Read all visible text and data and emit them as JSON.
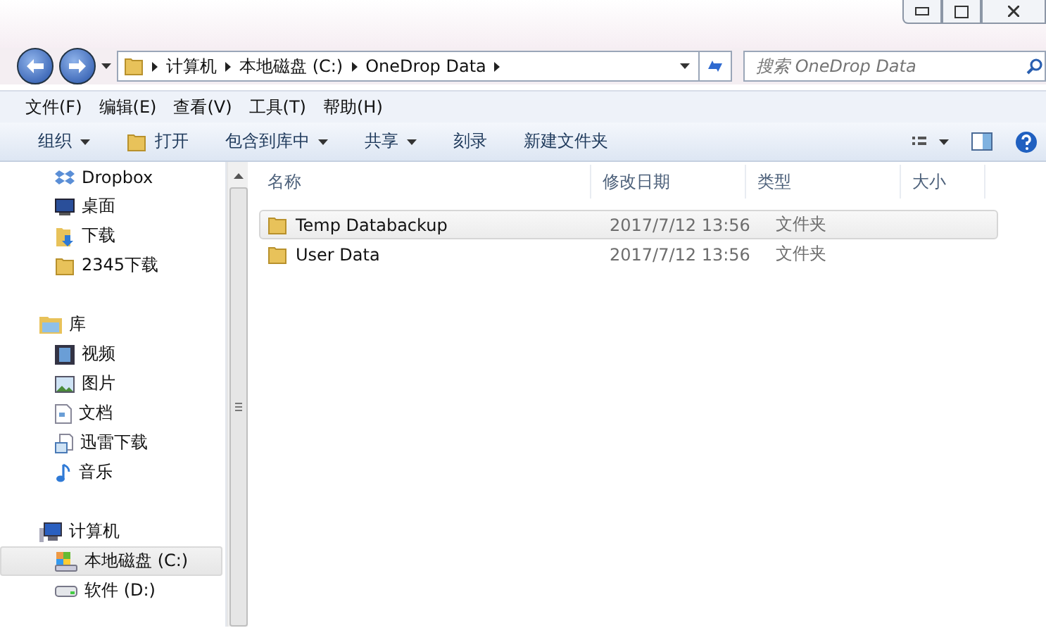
{
  "address_bar": {
    "segments": [
      "计算机",
      "本地磁盘 (C:)",
      "OneDrop Data"
    ]
  },
  "search": {
    "placeholder": "搜索 OneDrop Data"
  },
  "menu_bar": [
    "文件(F)",
    "编辑(E)",
    "查看(V)",
    "工具(T)",
    "帮助(H)"
  ],
  "toolbar": [
    {
      "label": "组织",
      "dropdown": true
    },
    {
      "label": "打开",
      "dropdown": false
    },
    {
      "label": "包含到库中",
      "dropdown": true
    },
    {
      "label": "共享",
      "dropdown": true
    },
    {
      "label": "刻录",
      "dropdown": false
    },
    {
      "label": "新建文件夹",
      "dropdown": false
    }
  ],
  "sidebar": {
    "sections": [
      {
        "items": [
          {
            "label": "Dropbox",
            "selected": false
          },
          {
            "label": "桌面",
            "selected": false
          },
          {
            "label": "下载",
            "selected": false
          },
          {
            "label": "2345下载",
            "selected": false
          }
        ]
      },
      {
        "title": "库",
        "items": [
          {
            "label": "视频",
            "selected": false
          },
          {
            "label": "图片",
            "selected": false
          },
          {
            "label": "文档",
            "selected": false
          },
          {
            "label": "迅雷下载",
            "selected": false
          },
          {
            "label": "音乐",
            "selected": false
          }
        ]
      },
      {
        "title": "计算机",
        "items": [
          {
            "label": "本地磁盘 (C:)",
            "selected": true
          },
          {
            "label": "软件 (D:)",
            "selected": false
          }
        ]
      }
    ]
  },
  "table": {
    "columns": [
      "名称",
      "修改日期",
      "类型",
      "大小"
    ],
    "rows": [
      {
        "name": "Temp Databackup",
        "modified": "2017/7/12 13:56",
        "type": "文件夹",
        "selected": true
      },
      {
        "name": "User Data",
        "modified": "2017/7/12 13:56",
        "type": "文件夹",
        "selected": false
      }
    ]
  }
}
